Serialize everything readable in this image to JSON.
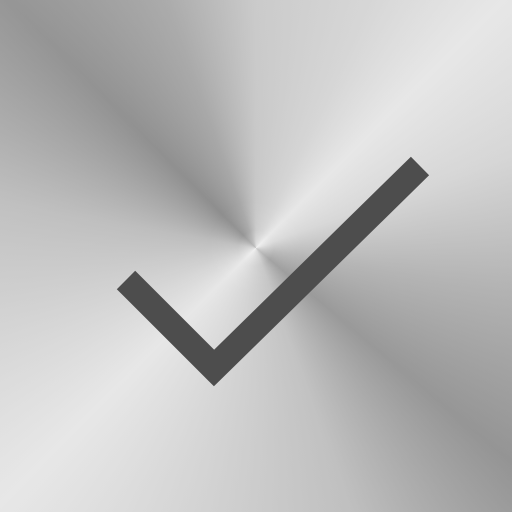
{
  "icon": {
    "name": "checkmark-icon",
    "background_style": "brushed-metal",
    "colors": {
      "checkmark": "#4d4d4d",
      "metal_light": "#ececec",
      "metal_mid": "#c9c9c9",
      "metal_dark": "#8a8a8a"
    }
  }
}
